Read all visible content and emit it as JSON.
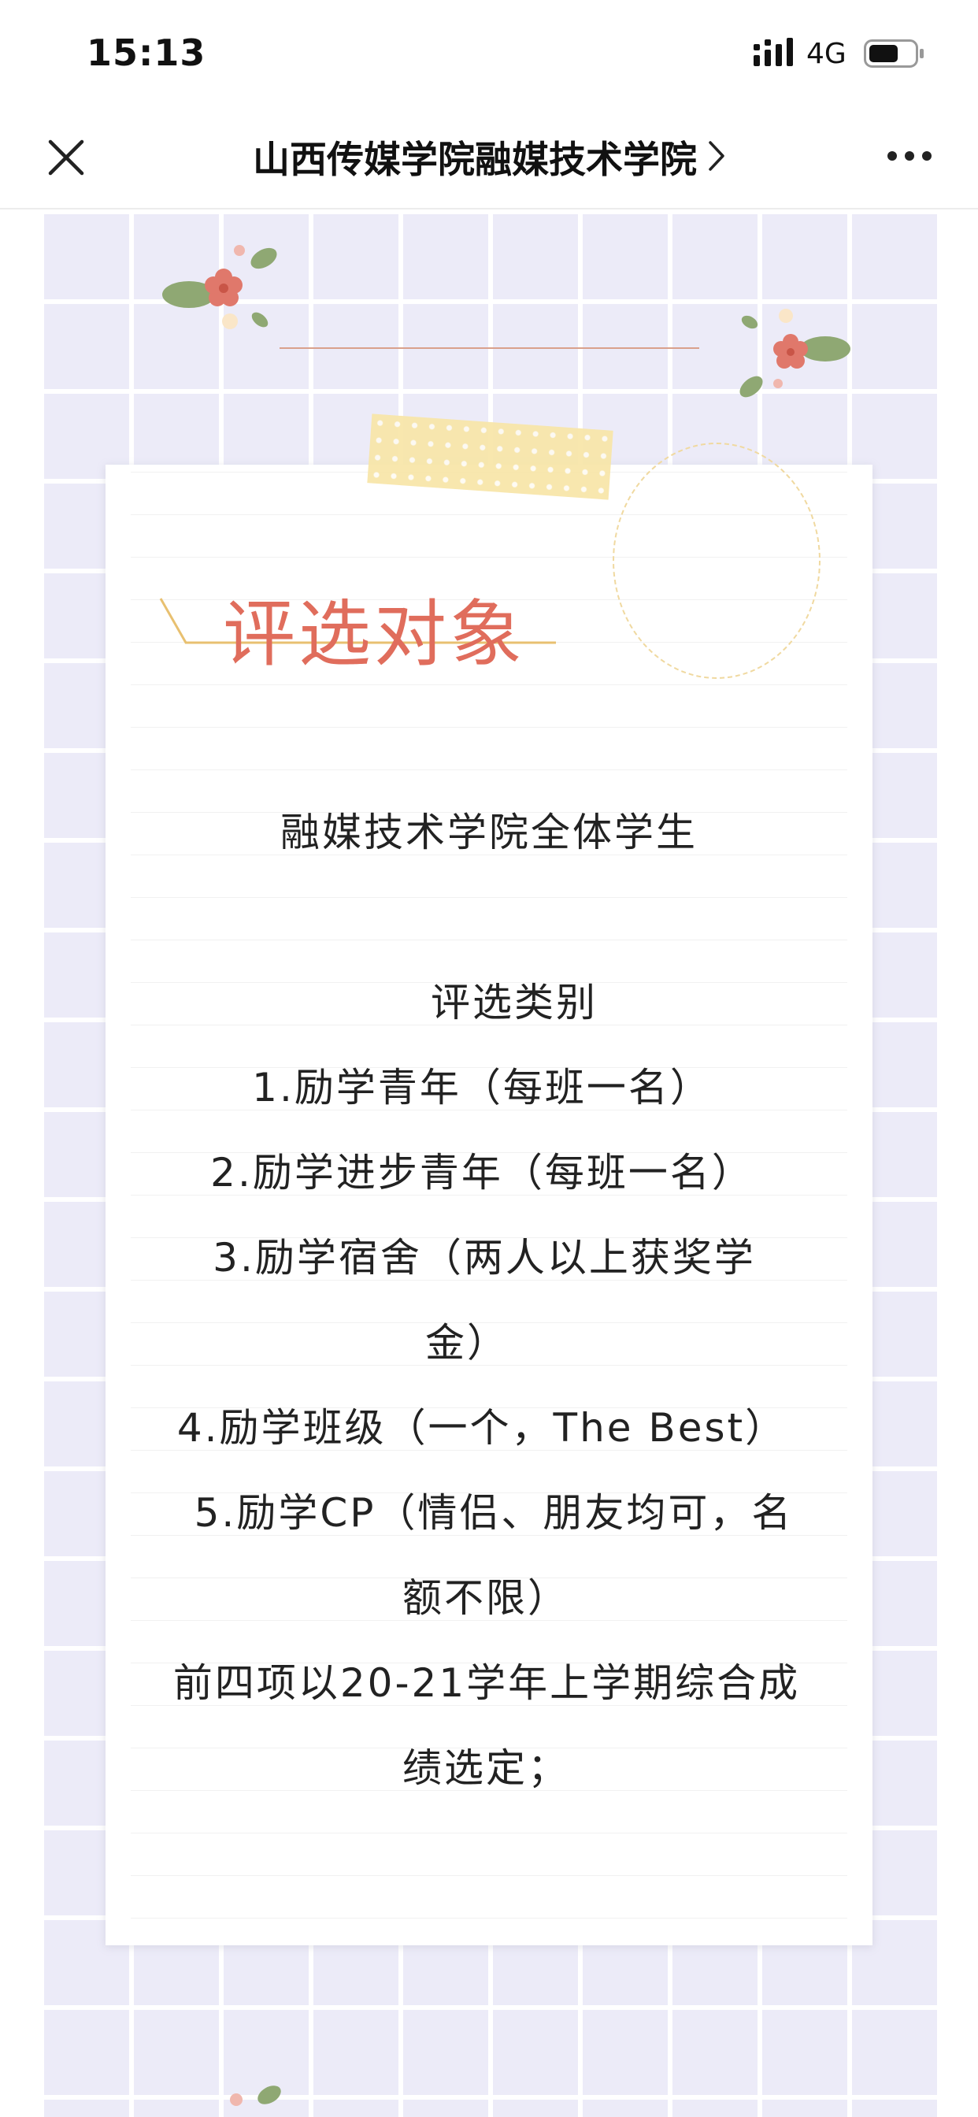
{
  "status_bar": {
    "time": "15:13",
    "network": "4G",
    "icons": [
      "signal-icon",
      "battery-icon"
    ]
  },
  "nav": {
    "title": "山西传媒学院融媒技术学院",
    "icons": [
      "close-icon",
      "chevron-right-icon",
      "more-icon"
    ]
  },
  "article": {
    "heading": "评选对象",
    "target_text": "融媒技术学院全体学生",
    "category_title": "评选类别",
    "lines": [
      "1.励学青年（每班一名）",
      "2.励学进步青年（每班一名）",
      "3.励学宿舍（两人以上获奖学",
      "金）",
      "4.励学班级（一个，The Best）",
      "5.励学CP（情侣、朋友均可，名",
      "额不限）",
      "前四项以20-21学年上学期综合成",
      "绩选定；"
    ]
  },
  "colors": {
    "accent": "#e06d5c",
    "grid_background": "#ecebf8",
    "tape": "#f8e6a8",
    "underline": "#e8c070"
  }
}
